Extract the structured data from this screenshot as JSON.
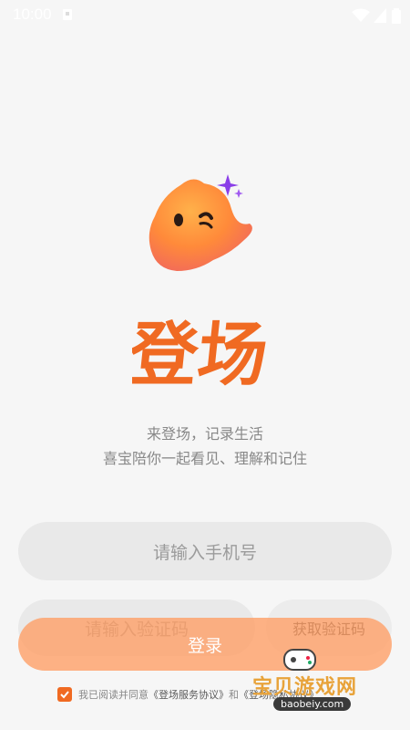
{
  "status_bar": {
    "time": "10:00"
  },
  "brand": {
    "title": "登场"
  },
  "tagline": {
    "line1": "来登场，记录生活",
    "line2": "喜宝陪你一起看见、理解和记住"
  },
  "form": {
    "phone_placeholder": "请输入手机号",
    "code_placeholder": "请输入验证码",
    "get_code_label": "获取验证码",
    "login_label": "登录"
  },
  "agreement": {
    "prefix": "我已阅读并同意",
    "service_link": "《登场服务协议》",
    "conjunction": "和",
    "privacy_link": "《登场隐私协议》",
    "checked": true
  },
  "watermark": {
    "text": "宝贝游戏网",
    "url": "baobeiy.com"
  },
  "colors": {
    "accent": "#f06a22",
    "login_button": "#ff9e64",
    "background": "#f6f6f6"
  }
}
